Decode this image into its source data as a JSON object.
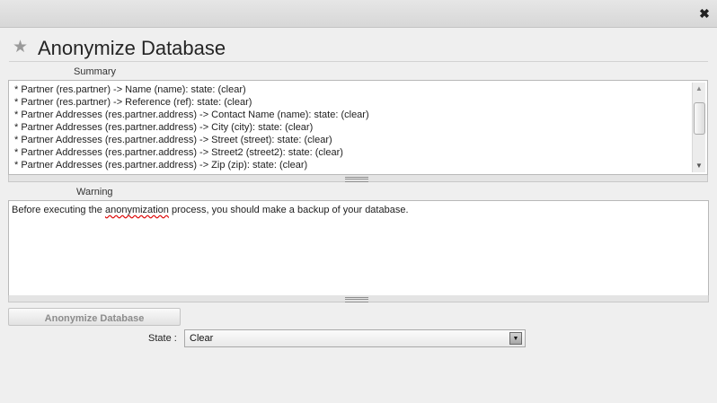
{
  "window": {
    "close_glyph": "✖"
  },
  "header": {
    "title": "Anonymize Database",
    "star_icon": "star-icon"
  },
  "summary": {
    "label": "Summary",
    "lines": [
      "* Partner (res.partner) -> Name (name): state: (clear)",
      "* Partner (res.partner) -> Reference (ref): state: (clear)",
      "* Partner Addresses (res.partner.address) -> Contact Name (name): state: (clear)",
      "* Partner Addresses (res.partner.address) -> City (city): state: (clear)",
      "* Partner Addresses (res.partner.address) -> Street (street): state: (clear)",
      "* Partner Addresses (res.partner.address) -> Street2 (street2): state: (clear)",
      "* Partner Addresses (res.partner.address) -> Zip (zip): state: (clear)"
    ]
  },
  "warning": {
    "label": "Warning",
    "text_before": "Before executing the ",
    "text_misspelled": "anonymization",
    "text_after": " process, you should make a backup of your database."
  },
  "actions": {
    "anonymize_label": "Anonymize Database"
  },
  "state": {
    "label": "State :",
    "selected": "Clear"
  },
  "colors": {
    "background": "#efefef",
    "field_border": "#b8b8b8",
    "disabled_text": "#8c8c8c"
  }
}
